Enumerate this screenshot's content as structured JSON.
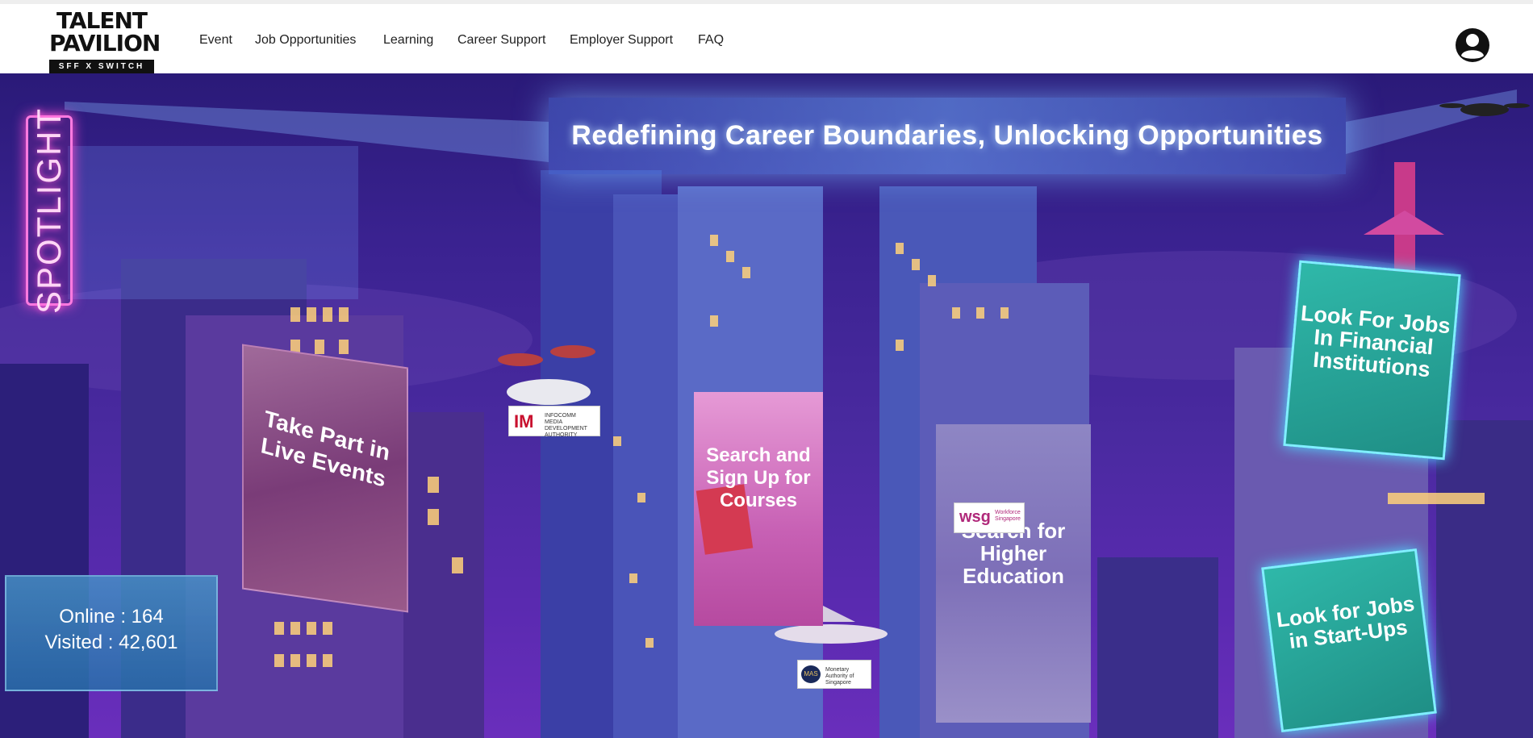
{
  "header": {
    "logo": {
      "line1": "TALENT",
      "line2": "PAVILION",
      "tagline": "SFF X SWITCH"
    },
    "nav": [
      {
        "label": "Event"
      },
      {
        "label": "Job Opportunities"
      },
      {
        "label": "Learning"
      },
      {
        "label": "Career Support"
      },
      {
        "label": "Employer Support"
      },
      {
        "label": "FAQ"
      }
    ],
    "profile_icon": "user-circle-icon"
  },
  "hero": {
    "banner_title": "Redefining Career Boundaries, Unlocking Opportunities",
    "spotlight_label": "SPOTLIGHT",
    "billboards": {
      "live_events": "Take Part in Live Events",
      "courses": "Search and Sign Up for Courses",
      "higher_education": "Search for Higher Education",
      "financial_jobs": "Look For Jobs In Financial Institutions",
      "startup_jobs": "Look for Jobs in Start-Ups"
    },
    "stats": {
      "online": "Online : 164",
      "visited": "Visited : 42,601"
    },
    "sponsor_logos": {
      "imda": {
        "mark": "IM",
        "text": "INFOCOMM MEDIA DEVELOPMENT AUTHORITY"
      },
      "wsg": {
        "mark": "wsg",
        "text": "Workforce Singapore"
      },
      "mas": {
        "mark": "MAS",
        "text": "Monetary Authority of Singapore"
      }
    }
  },
  "colors": {
    "header_bg": "#ffffff",
    "scene_bg": "#3a2290",
    "teal_billboard": "#2fb8a9",
    "neon_pink": "#ff7ae0",
    "banner_glow": "#6eaaff"
  }
}
